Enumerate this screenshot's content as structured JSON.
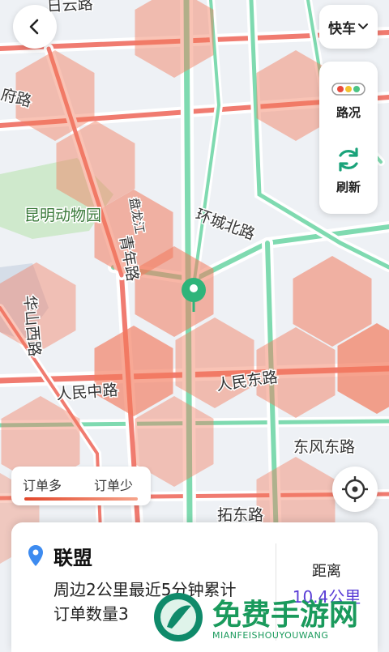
{
  "map": {
    "road_labels": [
      "日云路",
      "府路",
      "环城北路",
      "昆明动物园",
      "盘龙江",
      "青年路",
      "华山西路",
      "人民中路",
      "人民东路",
      "东风东路",
      "拓东路"
    ],
    "hex_color": "#f27a5c",
    "road_green": "#7fdab0",
    "road_red": "#f07b70"
  },
  "header": {
    "back_icon": "chevron-left-icon",
    "mode_label": "快车",
    "mode_icon": "chevron-down-icon"
  },
  "tools": {
    "traffic_label": "路况",
    "traffic_icon": "traffic-light-icon",
    "refresh_label": "刷新",
    "refresh_icon": "refresh-icon"
  },
  "legend": {
    "more_label": "订单多",
    "less_label": "订单少",
    "more_color": "#e2472b",
    "less_color": "#f6a58c"
  },
  "locate": {
    "icon": "crosshair-icon"
  },
  "card": {
    "pin_icon": "location-pin-icon",
    "name": "联盟",
    "desc_line1": "周边2公里最近5分钟累计",
    "desc_line2": "订单数量3",
    "distance_label": "距离",
    "distance_value": "10.4公里"
  },
  "watermark": {
    "title": "免费手游网",
    "subtitle": "MIANFEISHOUYOUWANG"
  }
}
